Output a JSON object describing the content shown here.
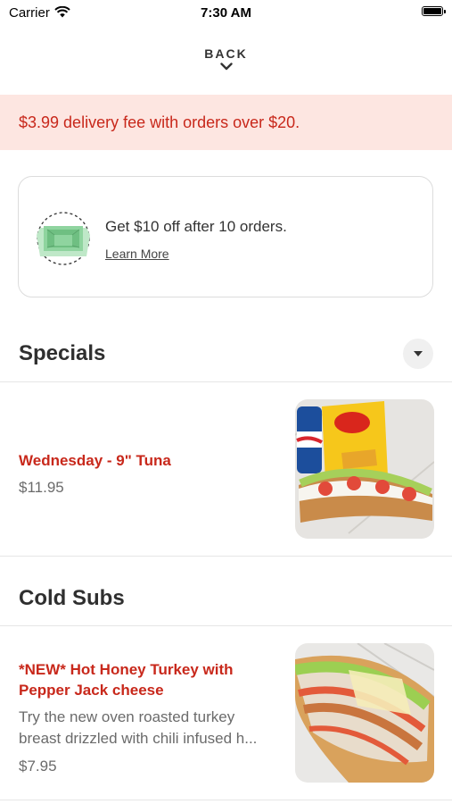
{
  "status_bar": {
    "carrier": "Carrier",
    "time": "7:30 AM"
  },
  "nav": {
    "back_label": "BACK"
  },
  "banner": {
    "text": "$3.99 delivery fee with orders over $20."
  },
  "promo": {
    "text": "Get $10 off after 10 orders.",
    "link": "Learn More"
  },
  "sections": [
    {
      "title": "Specials",
      "items": [
        {
          "name": "Wednesday - 9\" Tuna",
          "price": "$11.95"
        }
      ]
    },
    {
      "title": "Cold Subs",
      "items": [
        {
          "name": "*NEW* Hot Honey Turkey with Pepper Jack cheese",
          "description": "Try the new oven roasted turkey breast drizzled with chili infused h...",
          "price": "$7.95"
        }
      ]
    }
  ],
  "colors": {
    "accent": "#c8281b",
    "banner_bg": "#fde6e1",
    "divider": "#e6e6e6"
  }
}
